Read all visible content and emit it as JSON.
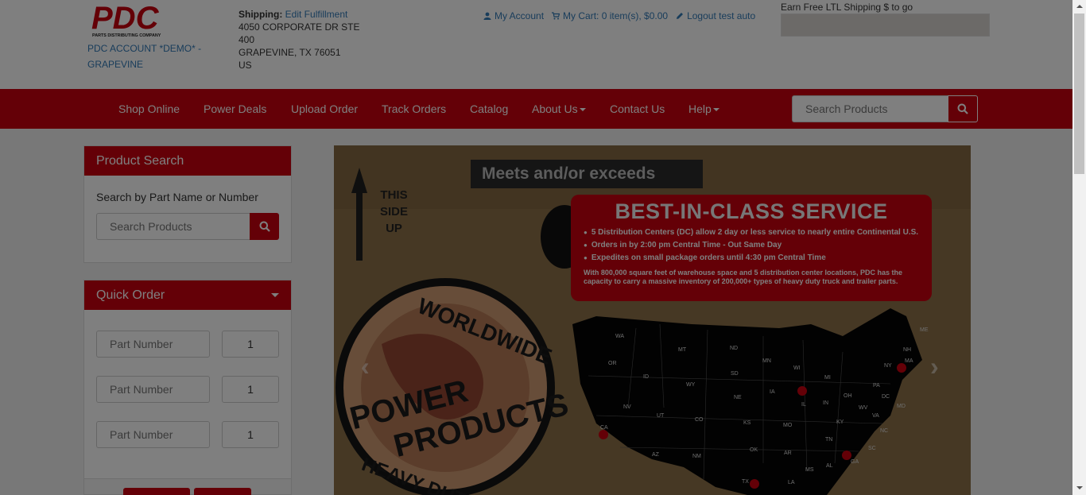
{
  "header": {
    "logo_text": "PDC",
    "logo_subtext": "PARTS DISTRIBUTING COMPANY",
    "account_name": "PDC ACCOUNT *DEMO* - GRAPEVINE",
    "shipping_label": "Shipping:",
    "edit_fulfillment": "Edit Fulfillment",
    "address_lines": [
      "4050 CORPORATE DR STE",
      "400",
      "GRAPEVINE, TX 76051",
      "US"
    ],
    "my_account": "My Account",
    "my_cart": "My Cart: 0 item(s), $0.00",
    "logout": "Logout test auto",
    "free_shipping": "Earn Free LTL Shipping $ to go"
  },
  "nav": {
    "items": [
      "Shop Online",
      "Power Deals",
      "Upload Order",
      "Track Orders",
      "Catalog",
      "About Us",
      "Contact Us",
      "Help"
    ],
    "search_placeholder": "Search Products"
  },
  "product_search": {
    "title": "Product Search",
    "label": "Search by Part Name or Number",
    "placeholder": "Search Products"
  },
  "quick_order": {
    "title": "Quick Order",
    "rows": [
      {
        "part_placeholder": "Part Number",
        "qty": "1"
      },
      {
        "part_placeholder": "Part Number",
        "qty": "1"
      },
      {
        "part_placeholder": "Part Number",
        "qty": "1"
      }
    ]
  },
  "banner": {
    "tagline": "Meets and/or exceeds",
    "this_side_up": [
      "THIS",
      "SIDE",
      "UP"
    ],
    "seal_lines": [
      "WORLDWIDE",
      "POWER",
      "PRODUCTS",
      "HEAVY DUTY"
    ],
    "title": "BEST-IN-CLASS SERVICE",
    "bullets": [
      "5 Distribution Centers (DC) allow 2 day or less service to nearly entire Continental U.S.",
      "Orders in by 2:00 pm Central Time - Out Same Day",
      "Expedites on small package orders until 4:30 pm Central Time"
    ],
    "description": "With 800,000 square feet of warehouse space and 5 distribution center locations, PDC has the capacity to carry a massive inventory of 200,000+ types of heavy duty truck and trailer parts.",
    "states": [
      "WA",
      "OR",
      "CA",
      "NV",
      "ID",
      "MT",
      "WY",
      "UT",
      "AZ",
      "CO",
      "NM",
      "ND",
      "SD",
      "NE",
      "KS",
      "OK",
      "TX",
      "MN",
      "IA",
      "MO",
      "AR",
      "LA",
      "WI",
      "IL",
      "MI",
      "IN",
      "OH",
      "KY",
      "TN",
      "MS",
      "AL",
      "GA",
      "SC",
      "NC",
      "VA",
      "WV",
      "PA",
      "NY",
      "ME",
      "NH",
      "MA",
      "DC",
      "MD"
    ]
  },
  "colors": {
    "brand_red": "#c8000f",
    "link_blue": "#337ab7"
  }
}
